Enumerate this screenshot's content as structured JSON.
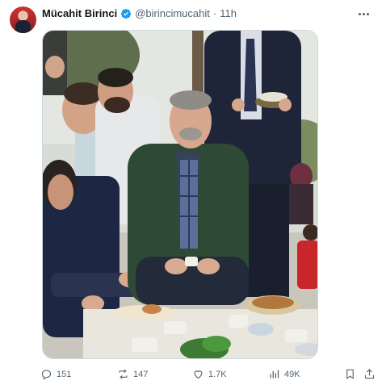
{
  "tweet": {
    "author_name": "Mücahit Birinci",
    "handle": "@birincimucahit",
    "separator": "·",
    "time": "11h",
    "verified_color": "#1d9bf0",
    "avatar_icon": "profile-avatar"
  },
  "media": {
    "type": "photo",
    "description_icon": "photo-image"
  },
  "actions": {
    "replies": "151",
    "reposts": "147",
    "likes": "1.7K",
    "views": "49K",
    "icons": [
      "reply-icon",
      "repost-icon",
      "like-icon",
      "views-icon",
      "bookmark-icon",
      "share-icon"
    ]
  },
  "colors": {
    "text": "#0f1419",
    "secondary": "#536471",
    "accent": "#1d9bf0"
  }
}
